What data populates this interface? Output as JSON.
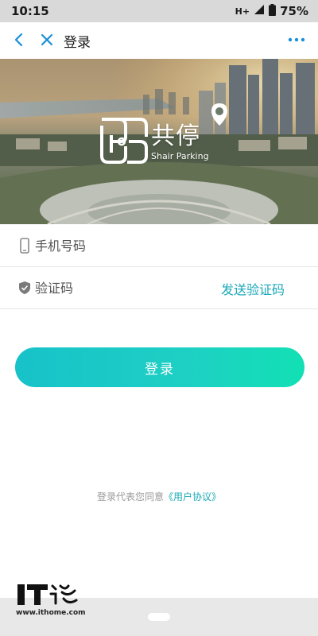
{
  "status_bar": {
    "time": "10:15",
    "network": "H+",
    "battery": "75%"
  },
  "header": {
    "title": "登录",
    "back_icon": "chevron-left-icon",
    "close_icon": "close-icon",
    "more_icon": "more-dots-icon",
    "accent_color": "#1a8fd6"
  },
  "banner": {
    "brand_name": "共停",
    "brand_sub": "Shair Parking"
  },
  "form": {
    "phone": {
      "placeholder": "手机号码",
      "value": "",
      "icon": "phone-icon"
    },
    "code": {
      "placeholder": "验证码",
      "value": "",
      "icon": "shield-icon"
    },
    "send_code_label": "发送验证码"
  },
  "login_button": {
    "label": "登录"
  },
  "agreement": {
    "prefix": "登录代表您同意",
    "link": "《用户协议》"
  },
  "watermark": {
    "url": "www.ithome.com"
  },
  "colors": {
    "teal": "#1aa8b8",
    "button_start": "#17c2c9",
    "button_end": "#12e0b4"
  }
}
